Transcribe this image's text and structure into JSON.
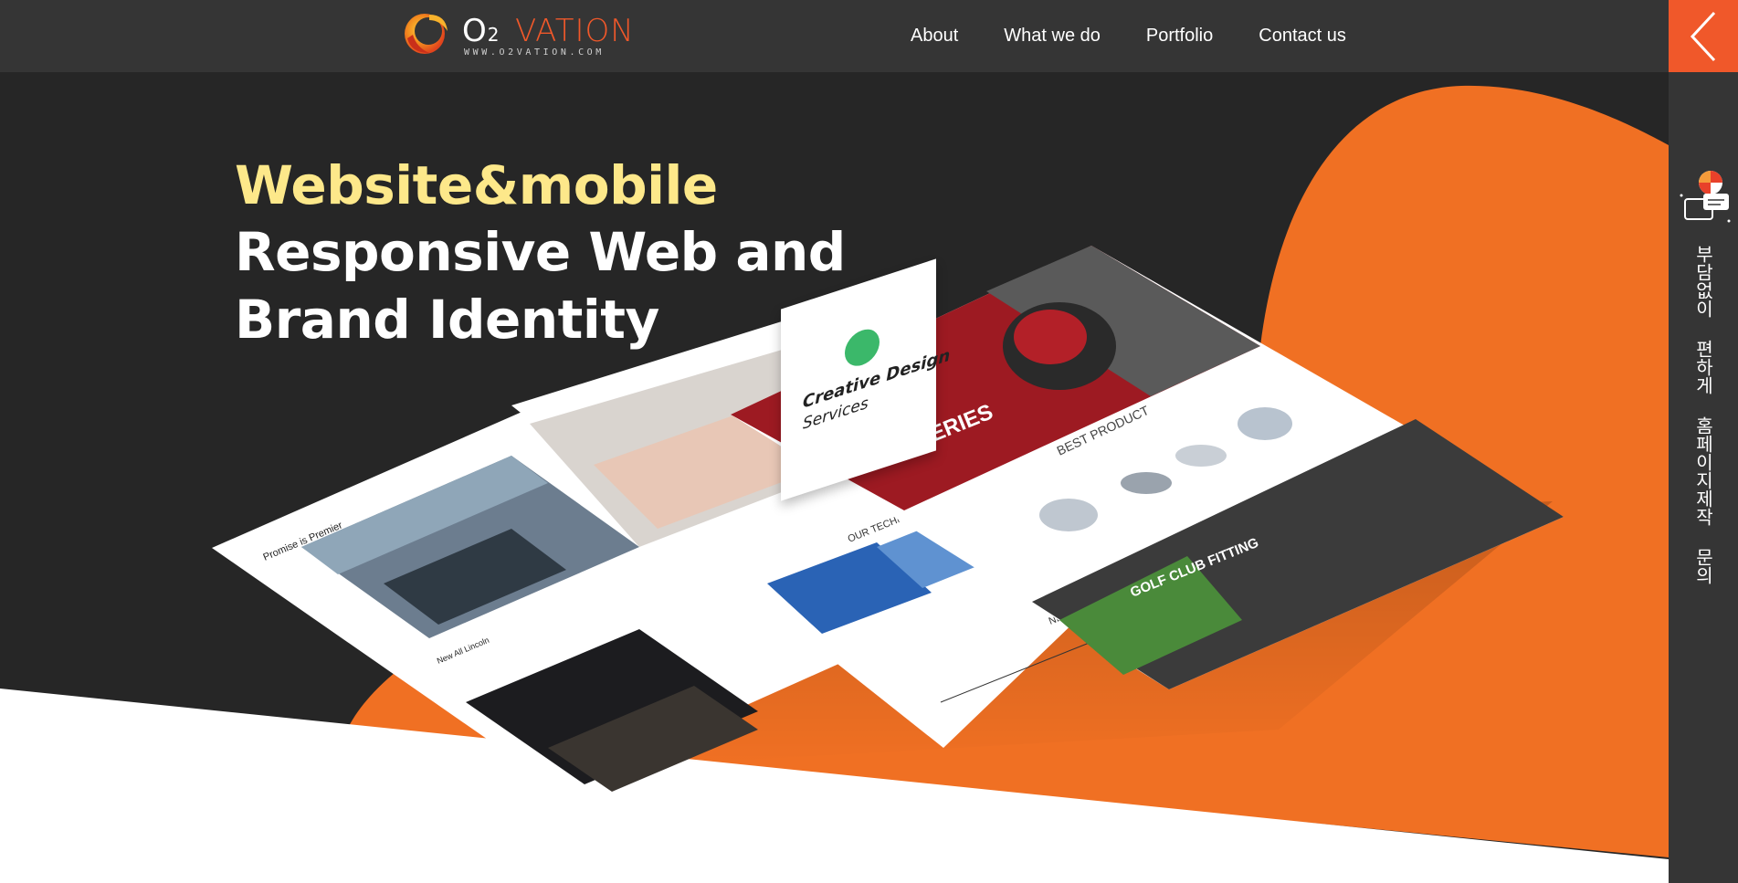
{
  "header": {
    "logo": {
      "wordmark_o2": "O",
      "wordmark_o2_sub": "2",
      "wordmark_vation": "VATION",
      "url": "WWW.O2VATION.COM"
    },
    "nav": [
      {
        "label": "About"
      },
      {
        "label": "What we do"
      },
      {
        "label": "Portfolio"
      },
      {
        "label": "Contact us"
      }
    ]
  },
  "hero": {
    "headline_line1": "Website&mobile",
    "headline_line2": "Responsive Web and",
    "headline_line3": "Brand Identity",
    "card": {
      "title": "Creative Design",
      "subtitle": "Services"
    },
    "mockups": {
      "golf_series": "P-SERIES",
      "best_product": "BEST PRODUCT",
      "golf_fitting": "GOLF CLUB FITTING",
      "car_headline": "Promise is Premier",
      "car_sub": "New All Lincoln",
      "research_heading": "OUR TECHNOLOGY",
      "news_heading": "NEWS"
    }
  },
  "side_panel": {
    "inquiry_text": "부담없이 편하게 홈페이지제작 문의"
  },
  "colors": {
    "header_bg": "#353535",
    "hero_dark": "#262626",
    "accent_orange": "#f07023",
    "highlight_yellow": "#fde88a",
    "toggle_orange": "#f0582a"
  }
}
